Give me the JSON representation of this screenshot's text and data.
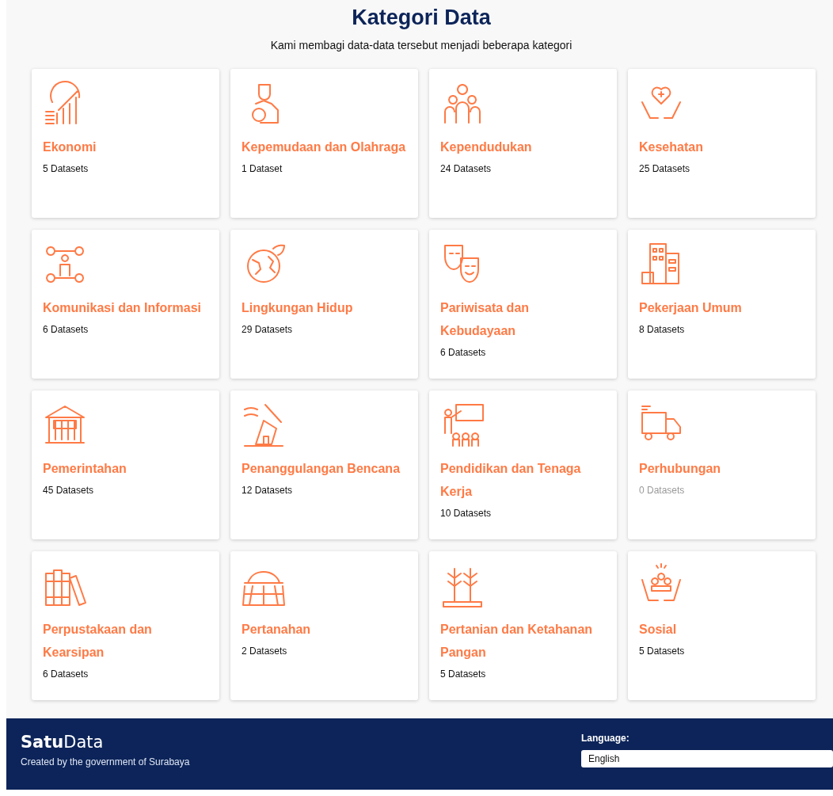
{
  "header": {
    "title": "Kategori Data",
    "subtitle": "Kami membagi data-data tersebut menjadi beberapa kategori"
  },
  "categories": [
    {
      "name": "Ekonomi",
      "count": "5 Datasets",
      "disabled": false
    },
    {
      "name": "Kepemudaan dan Olahraga",
      "count": "1 Dataset",
      "disabled": false
    },
    {
      "name": "Kependudukan",
      "count": "24 Datasets",
      "disabled": false
    },
    {
      "name": "Kesehatan",
      "count": "25 Datasets",
      "disabled": false
    },
    {
      "name": "Komunikasi dan Informasi",
      "count": "6 Datasets",
      "disabled": false
    },
    {
      "name": "Lingkungan Hidup",
      "count": "29 Datasets",
      "disabled": false
    },
    {
      "name": "Pariwisata dan Kebudayaan",
      "count": "6 Datasets",
      "disabled": false
    },
    {
      "name": "Pekerjaan Umum",
      "count": "8 Datasets",
      "disabled": false
    },
    {
      "name": "Pemerintahan",
      "count": "45 Datasets",
      "disabled": false
    },
    {
      "name": "Penanggulangan Bencana",
      "count": "12 Datasets",
      "disabled": false
    },
    {
      "name": "Pendidikan dan Tenaga Kerja",
      "count": "10 Datasets",
      "disabled": false
    },
    {
      "name": "Perhubungan",
      "count": "0 Datasets",
      "disabled": true
    },
    {
      "name": "Perpustakaan dan Kearsipan",
      "count": "6 Datasets",
      "disabled": false
    },
    {
      "name": "Pertanahan",
      "count": "2 Datasets",
      "disabled": false
    },
    {
      "name": "Pertanian dan Ketahanan Pangan",
      "count": "5 Datasets",
      "disabled": false
    },
    {
      "name": "Sosial",
      "count": "5 Datasets",
      "disabled": false
    }
  ],
  "footer": {
    "logo_bold": "Satu",
    "logo_light": "Data",
    "caption": "Created by the government of Surabaya",
    "language_label": "Language:",
    "language_value": "English"
  }
}
